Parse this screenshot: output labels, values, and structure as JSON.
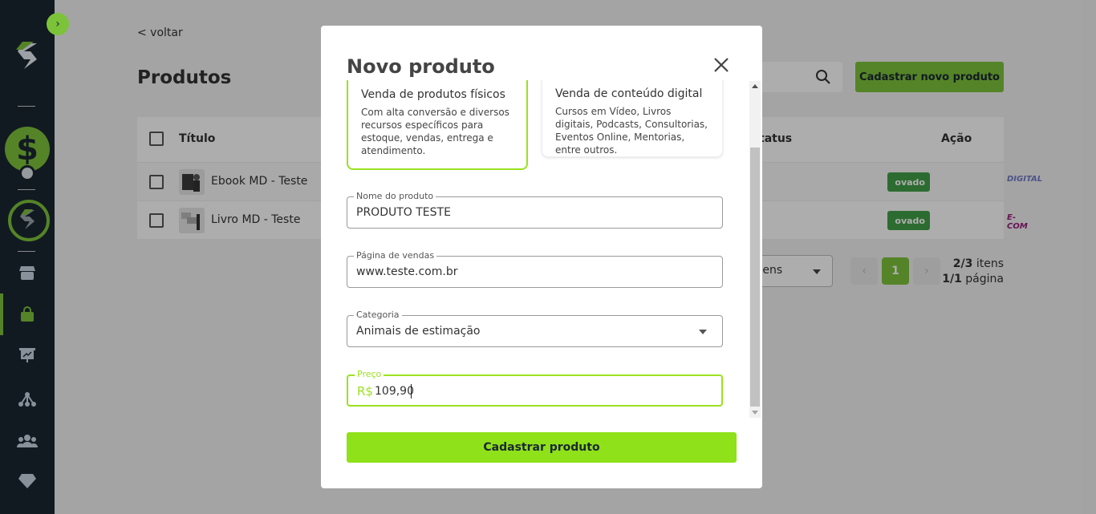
{
  "page": {
    "back_label": "< voltar",
    "title": "Produtos",
    "new_product_button": "Cadastrar novo produto"
  },
  "table": {
    "headers": {
      "title": "Título",
      "status": "tatus",
      "action": "Ação"
    },
    "rows": [
      {
        "title": "Ebook MD - Teste",
        "status": "ovado",
        "brand": "DIGITAL"
      },
      {
        "title": "Livro MD - Teste",
        "status": "ovado",
        "brand": "E-COM"
      }
    ]
  },
  "pagination": {
    "per_page": "itens",
    "current_page": "1",
    "prev": "‹",
    "next": "›",
    "items_count": "2/3",
    "items_label": " itens",
    "page_count": "1/1",
    "page_label": " página"
  },
  "modal": {
    "title": "Novo produto",
    "options": [
      {
        "title": "Venda de produtos físicos",
        "description": "Com alta conversão e diversos recursos específicos para estoque, vendas, entrega e atendimento.",
        "selected": true
      },
      {
        "title": "Venda de conteúdo digital",
        "description": "Cursos em Vídeo, Livros digitais, Podcasts, Consultorias, Eventos Online, Mentorias, entre outros.",
        "selected": false
      }
    ],
    "fields": {
      "name": {
        "label": "Nome do produto",
        "value": "PRODUTO TESTE"
      },
      "sales_page": {
        "label": "Página de vendas",
        "value": "www.teste.com.br"
      },
      "category": {
        "label": "Categoria",
        "value": "Animais de estimação"
      },
      "price": {
        "label": "Preço",
        "prefix": "R$",
        "value": "109,90"
      }
    },
    "submit_label": "Cadastrar produto"
  },
  "sidebar": {
    "toggle": "›",
    "balance_icon": "$"
  },
  "colors": {
    "brand_green": "#7cc33a",
    "bright_green": "#9ae21e",
    "sidebar_bg": "#1b2732",
    "status_green": "#43a047",
    "digital_badge": "#6f7bc9",
    "ecom_badge": "#9a1b7c"
  },
  "icons": [
    "sidebar-toggle-chevron-icon",
    "logo-icon",
    "dollar-icon",
    "gear-icon",
    "store-icon",
    "bag-icon",
    "presentation-chart-icon",
    "network-icon",
    "users-icon",
    "diamond-icon",
    "search-icon",
    "close-icon",
    "kebab-icon",
    "chevron-down-icon"
  ]
}
